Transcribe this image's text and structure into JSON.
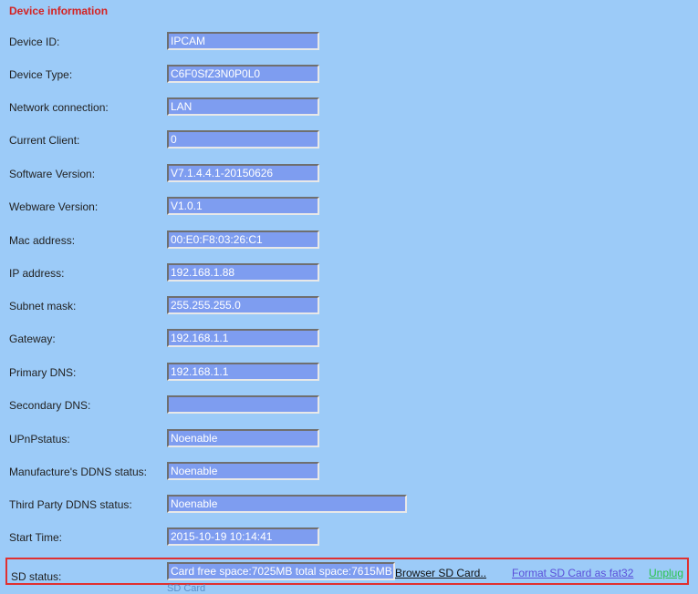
{
  "section_title": "Device information",
  "rows": [
    {
      "label": "Device ID:",
      "value": "IPCAM"
    },
    {
      "label": "Device Type:",
      "value": "C6F0SfZ3N0P0L0"
    },
    {
      "label": "Network connection:",
      "value": "LAN"
    },
    {
      "label": "Current Client:",
      "value": "0"
    },
    {
      "label": "Software Version:",
      "value": "V7.1.4.4.1-20150626"
    },
    {
      "label": "Webware Version:",
      "value": "V1.0.1"
    },
    {
      "label": "Mac address:",
      "value": "00:E0:F8:03:26:C1"
    },
    {
      "label": "IP address:",
      "value": "192.168.1.88"
    },
    {
      "label": "Subnet mask:",
      "value": "255.255.255.0"
    },
    {
      "label": "Gateway:",
      "value": "192.168.1.1"
    },
    {
      "label": "Primary DNS:",
      "value": "192.168.1.1"
    },
    {
      "label": "Secondary DNS:",
      "value": ""
    },
    {
      "label": "UPnPstatus:",
      "value": "Noenable"
    },
    {
      "label": "Manufacture's DDNS status:",
      "value": "Noenable"
    },
    {
      "label": "Third Party DDNS status:",
      "value": "Noenable"
    },
    {
      "label": "Start Time:",
      "value": "2015-10-19 10:14:41"
    }
  ],
  "sd": {
    "label": "SD status:",
    "value": "Card free space:7025MB total space:7615MB",
    "browse_label": "Browser SD Card..",
    "format_label": "Format SD Card as fat32",
    "unplug_label": "Unplug",
    "sub_label": "SD Card"
  },
  "colors": {
    "background": "#9ccbf8",
    "title": "#d42222",
    "field_fill": "#7e9df0",
    "highlight_border": "#e03030",
    "format_link": "#5a4fd9",
    "unplug_link": "#29c34a"
  }
}
